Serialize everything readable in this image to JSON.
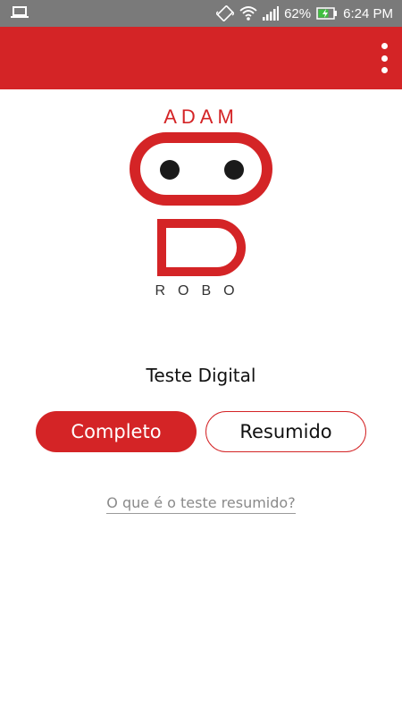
{
  "status_bar": {
    "battery_percent": "62%",
    "time": "6:24 PM",
    "icons": [
      "laptop-icon",
      "vibrate-icon",
      "wifi-icon",
      "signal-icon",
      "battery-charging-icon"
    ]
  },
  "app_bar": {
    "menu_icon": "more-vertical-icon",
    "color": "#d42426"
  },
  "logo": {
    "top_text": "ADAM",
    "bottom_text": "ROBO",
    "color": "#d42426"
  },
  "main": {
    "subtitle": "Teste Digital",
    "complete_button": "Completo",
    "summary_button": "Resumido",
    "help_link": "O que é o teste resumido?"
  },
  "colors": {
    "accent": "#d42426",
    "status_bar": "#7a7a7a"
  }
}
